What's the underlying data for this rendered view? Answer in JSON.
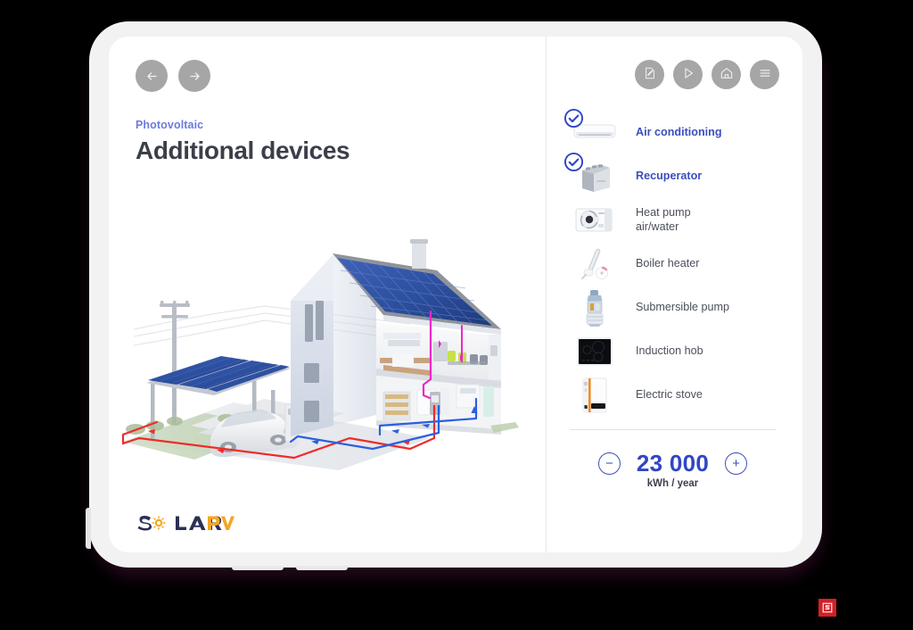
{
  "app": {
    "brand_logo_text_1": "SOLAR",
    "brand_logo_text_2": "PV"
  },
  "left": {
    "nav": {
      "back_label": "←",
      "forward_label": "→"
    },
    "eyebrow": "Photovoltaic",
    "title": "Additional devices",
    "illustration_name": "house-solar-system-cutaway"
  },
  "toolbar": {
    "items": [
      {
        "name": "edit-note-icon",
        "label": "Edit"
      },
      {
        "name": "play-icon",
        "label": "Play"
      },
      {
        "name": "home-icon",
        "label": "Home"
      },
      {
        "name": "menu-icon",
        "label": "Menu"
      }
    ]
  },
  "devices": {
    "items": [
      {
        "label": "Air conditioning",
        "selected": true,
        "icon": "air-conditioner-icon"
      },
      {
        "label": "Recuperator",
        "selected": true,
        "icon": "recuperator-icon"
      },
      {
        "label": "Heat pump\nair/water",
        "selected": false,
        "icon": "heat-pump-icon"
      },
      {
        "label": "Boiler heater",
        "selected": false,
        "icon": "boiler-heater-icon"
      },
      {
        "label": "Submersible pump",
        "selected": false,
        "icon": "submersible-pump-icon"
      },
      {
        "label": "Induction hob",
        "selected": false,
        "icon": "induction-hob-icon"
      },
      {
        "label": "Electric stove",
        "selected": false,
        "icon": "electric-stove-icon"
      }
    ]
  },
  "counter": {
    "decrement_label": "−",
    "increment_label": "+",
    "value": "23 000",
    "unit": "kWh / year"
  },
  "badge": {
    "name": "red-s-badge",
    "text": "S"
  },
  "colors": {
    "accent_blue": "#3b4fbd",
    "value_blue": "#2f46c4",
    "eyebrow_blue": "#6c7ae0",
    "title_dark": "#3b3f4a",
    "label_gray": "#4a4f5a",
    "button_gray": "#a6a6a6",
    "logo_navy": "#2b3054",
    "logo_orange": "#f5a623",
    "badge_red": "#d32027",
    "bezel": "#f2f2f3",
    "screen": "#ffffff",
    "background": "#000000"
  }
}
